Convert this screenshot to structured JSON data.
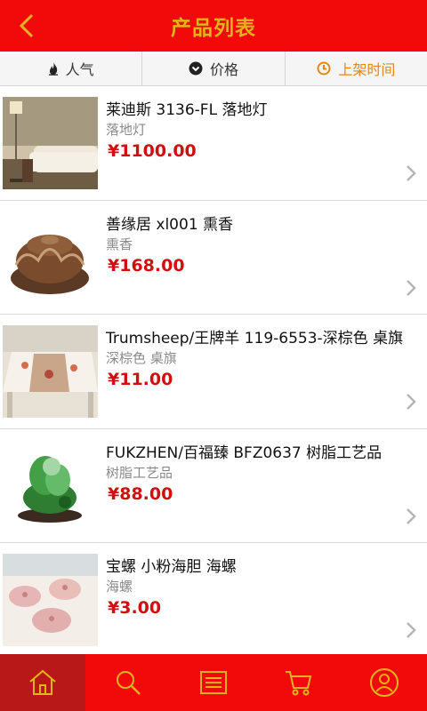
{
  "header": {
    "title": "产品列表"
  },
  "sort_tabs": [
    {
      "label": "人气",
      "icon": "flame-icon"
    },
    {
      "label": "价格",
      "icon": "chevron-circle-down-icon"
    },
    {
      "label": "上架时间",
      "icon": "clock-icon"
    }
  ],
  "products": [
    {
      "name": "莱迪斯 3136-FL 落地灯",
      "category": "落地灯",
      "price": "¥1100.00"
    },
    {
      "name": "善缘居 xl001 熏香",
      "category": "熏香",
      "price": "¥168.00"
    },
    {
      "name": "Trumsheep/王牌羊 119-6553-深棕色 桌旗",
      "category": "深棕色 桌旗",
      "price": "¥11.00"
    },
    {
      "name": "FUKZHEN/百福臻 BFZ0637 树脂工艺品",
      "category": "树脂工艺品",
      "price": "¥88.00"
    },
    {
      "name": "宝螺 小粉海胆 海螺",
      "category": "海螺",
      "price": "¥3.00"
    }
  ],
  "bottom_nav": [
    {
      "icon": "home-icon"
    },
    {
      "icon": "search-icon"
    },
    {
      "icon": "list-icon"
    },
    {
      "icon": "cart-icon"
    },
    {
      "icon": "user-icon"
    }
  ],
  "colors": {
    "header_bg": "#f20909",
    "title": "#e2b31d",
    "price": "#d01010",
    "active_sort": "#e2871d",
    "nav_active": "#b81818"
  }
}
